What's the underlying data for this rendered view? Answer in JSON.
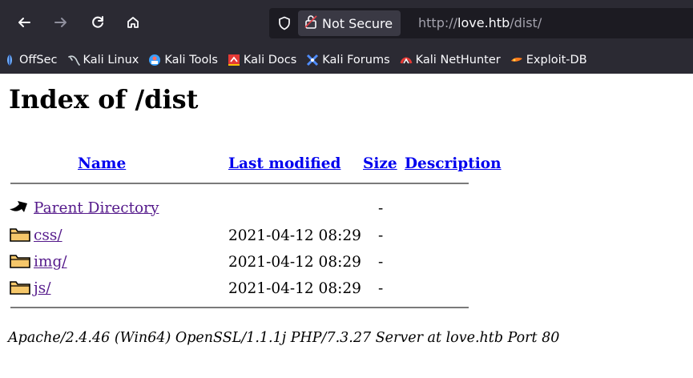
{
  "browser": {
    "url_security_label": "Not Secure",
    "url_prefix": "http://",
    "url_host": "love.htb",
    "url_path": "/dist/",
    "bookmarks": [
      {
        "label": "OffSec",
        "icon": "offsec-icon",
        "color": "#6fb0ff"
      },
      {
        "label": "Kali Linux",
        "icon": "kali-dragon-icon",
        "color": "#cfd8dc"
      },
      {
        "label": "Kali Tools",
        "icon": "kali-tools-icon",
        "color": "#3aa0ff"
      },
      {
        "label": "Kali Docs",
        "icon": "kali-docs-icon",
        "color": "#e53935"
      },
      {
        "label": "Kali Forums",
        "icon": "kali-forums-icon",
        "color": "#4f8dff"
      },
      {
        "label": "Kali NetHunter",
        "icon": "kali-nethunter-icon",
        "color": "#e53935"
      },
      {
        "label": "Exploit-DB",
        "icon": "exploit-db-icon",
        "color": "#ff7a1a"
      }
    ]
  },
  "page": {
    "title": "Index of /dist",
    "headers": {
      "name": "Name",
      "modified": "Last modified",
      "size": "Size",
      "description": "Description"
    },
    "parent": {
      "name": "Parent Directory",
      "modified": "",
      "size": "-"
    },
    "rows": [
      {
        "name": "css/",
        "modified": "2021-04-12 08:29",
        "size": "-"
      },
      {
        "name": "img/",
        "modified": "2021-04-12 08:29",
        "size": "-"
      },
      {
        "name": "js/",
        "modified": "2021-04-12 08:29",
        "size": "-"
      }
    ],
    "footer": "Apache/2.4.46 (Win64) OpenSSL/1.1.1j PHP/7.3.27 Server at love.htb Port 80"
  }
}
